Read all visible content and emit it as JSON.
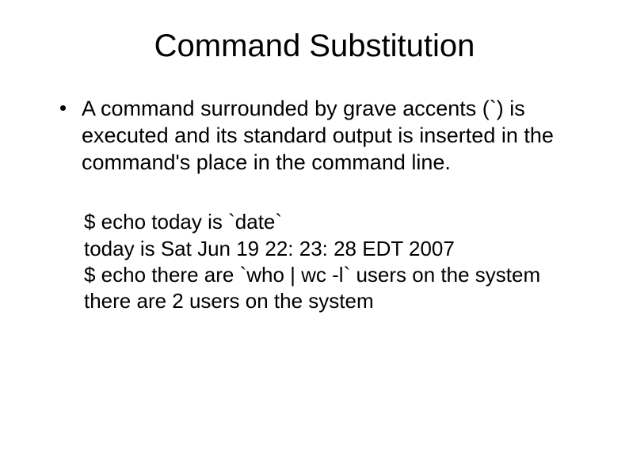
{
  "title": "Command Substitution",
  "bullet": "A command surrounded by grave accents (`) is executed and its standard output is inserted in the command's place in the command line.",
  "example": {
    "line1": "$ echo today is `date`",
    "line2": "today is Sat Jun 19 22: 23: 28 EDT 2007",
    "line3": "$ echo there are `who | wc -l` users on the system",
    "line4": "there are 2 users on the system"
  }
}
